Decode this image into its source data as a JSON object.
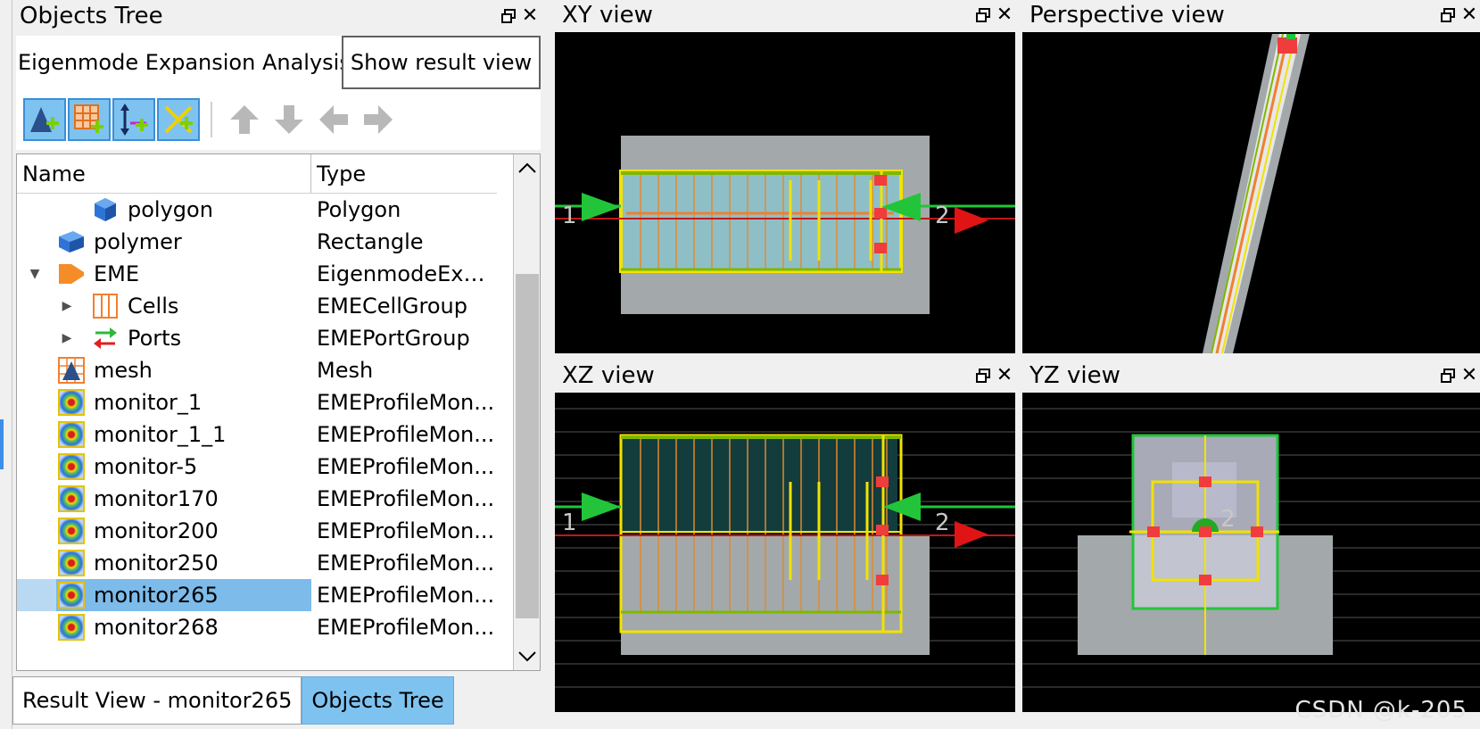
{
  "tree_panel": {
    "title": "Objects Tree",
    "mode_label": "Eigenmode Expansion Analysis",
    "mode_button": "Show result view",
    "columns": {
      "name": "Name",
      "type": "Type"
    },
    "rows": [
      {
        "name": "polygon",
        "type": "Polygon",
        "icon": "polygon-icon"
      },
      {
        "name": "polymer",
        "type": "Rectangle",
        "icon": "rectangle-icon"
      },
      {
        "name": "EME",
        "type": "EigenmodeExp...",
        "icon": "eme-icon"
      },
      {
        "name": "Cells",
        "type": "EMECellGroup",
        "icon": "cells-icon"
      },
      {
        "name": "Ports",
        "type": "EMEPortGroup",
        "icon": "ports-icon"
      },
      {
        "name": "mesh",
        "type": "Mesh",
        "icon": "mesh-icon"
      },
      {
        "name": "monitor_1",
        "type": "EMEProfileMon...",
        "icon": "monitor-icon"
      },
      {
        "name": "monitor_1_1",
        "type": "EMEProfileMon...",
        "icon": "monitor-icon"
      },
      {
        "name": "monitor-5",
        "type": "EMEProfileMon...",
        "icon": "monitor-icon"
      },
      {
        "name": "monitor170",
        "type": "EMEProfileMon...",
        "icon": "monitor-icon"
      },
      {
        "name": "monitor200",
        "type": "EMEProfileMon...",
        "icon": "monitor-icon"
      },
      {
        "name": "monitor250",
        "type": "EMEProfileMon...",
        "icon": "monitor-icon"
      },
      {
        "name": "monitor265",
        "type": "EMEProfileMon...",
        "icon": "monitor-icon",
        "selected": true
      },
      {
        "name": "monitor268",
        "type": "EMEProfileMon...",
        "icon": "monitor-icon"
      }
    ],
    "bottom_tabs": [
      {
        "label": "Result View - monitor265",
        "active": false
      },
      {
        "label": "Objects Tree",
        "active": true
      }
    ]
  },
  "views": {
    "xy": {
      "title": "XY view",
      "port1": "1",
      "port2": "2"
    },
    "perspective": {
      "title": "Perspective view"
    },
    "xz": {
      "title": "XZ view",
      "port1": "1",
      "port2": "2"
    },
    "yz": {
      "title": "YZ view",
      "label": "2"
    }
  },
  "watermark": "CSDN @k-205",
  "colors": {
    "selection": "#7cbbea",
    "tab_active": "#7ec3f0",
    "canvas_bg": "#000000",
    "structure_gray": "#a3a9ab",
    "waveguide": "#8fbfc6",
    "boundary_yellow": "#f2e200",
    "port_green": "#22c53a",
    "port_red": "#e01414",
    "handle_red": "#f03c3c"
  }
}
